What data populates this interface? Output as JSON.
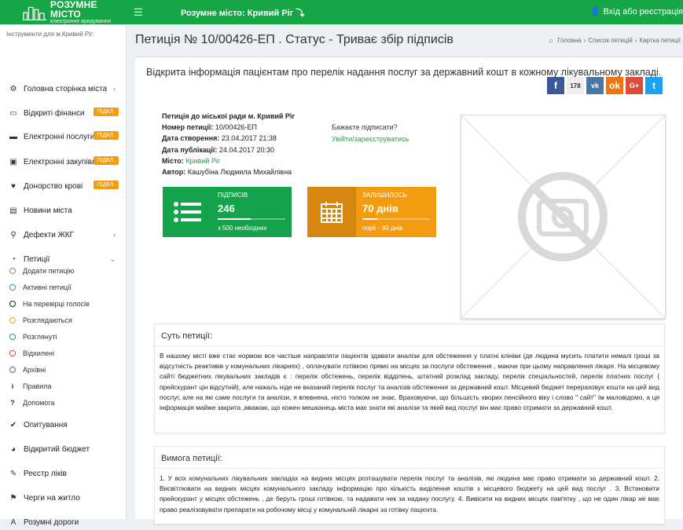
{
  "header": {
    "logo_title": "РОЗУМНЕ МІСТО",
    "logo_subtitle": "електронне врядування",
    "menu_icon": "☰",
    "city_label": "Розумне місто: Кривий Ріг ⤵",
    "login_label": "Вхід або реєстрація"
  },
  "sidebar": {
    "heading": "Інструменти для м.Кривий Ріг:",
    "items": [
      {
        "label": "Головна сторінка міста",
        "icon": "⚙",
        "chev": "‹"
      },
      {
        "label": "Відкриті фінанси",
        "icon": "▭",
        "badge": "ПІДКЛ."
      },
      {
        "label": "Електронні послуги",
        "icon": "▬",
        "badge": "ПІДКЛ."
      },
      {
        "label": "Електронні закупівлі",
        "icon": "▣",
        "badge": "ПІДКЛ."
      },
      {
        "label": "Донорство крові",
        "icon": "♥",
        "badge": "ПІДКЛ."
      },
      {
        "label": "Новини міста",
        "icon": "▤"
      },
      {
        "label": "Дефекти ЖКГ",
        "icon": "⚲",
        "chev": "‹"
      },
      {
        "label": "Петиції",
        "icon": "◔",
        "chev": "⌄"
      }
    ],
    "subitems": [
      {
        "label": "Додати петицію",
        "color": "#888888"
      },
      {
        "label": "Активні петиції",
        "color": "#3c8dbc"
      },
      {
        "label": "На перевірці голосів",
        "color": "#222222"
      },
      {
        "label": "Розглядаються",
        "color": "#f39c12"
      },
      {
        "label": "Розглянуті",
        "color": "#17a645"
      },
      {
        "label": "Відхилені",
        "color": "#dd4b39"
      },
      {
        "label": "Архівні",
        "color": "#666666"
      },
      {
        "label": "Правила",
        "color": "#444444",
        "icon": "i"
      },
      {
        "label": "Допомога",
        "color": "#444444",
        "icon": "?"
      }
    ],
    "bottom": [
      {
        "label": "Опитування",
        "icon": "✔"
      },
      {
        "label": "Відкритий бюджет",
        "icon": "◕"
      },
      {
        "label": "Реєстр ліків",
        "icon": "✎"
      },
      {
        "label": "Черги на житло",
        "icon": "⚑"
      },
      {
        "label": "Розумні дороги",
        "icon": "A"
      }
    ]
  },
  "page": {
    "title": "Петиція № 10/00426-ЕП . Статус - Триває збір підписів",
    "breadcrumb": [
      "Головна",
      "Список петицій",
      "Картка петиції"
    ]
  },
  "petition": {
    "title": "Відкрита інформація пацієнтам про перелік надання послуг за державний кошт в кожному лікувальному закладі.",
    "share_count": "178",
    "to": "Петиція до міської ради м. Кривий Ріг",
    "number_label": "Номер петиції:",
    "number": "10/00426-ЕП",
    "created_label": "Дата створення:",
    "created": "23.04.2017 21:38",
    "published_label": "Дата публікації:",
    "published": "24.04.2017 20:30",
    "city_label": "Місто:",
    "city": "Кривий Ріг",
    "author_label": "Автор:",
    "author": "Кашубіна Людмила Михайлівна",
    "sign_question": "Бажаєте підписати?",
    "sign_link": "Увійти/зареєструватись",
    "signatures": {
      "label": "ПІДПИСІВ",
      "value": "246",
      "foot": "з 500 необхідних",
      "progress": 0.49,
      "color": "#16a34a"
    },
    "remaining": {
      "label": "ЗАЛИШИЛОСЬ",
      "value": "70 днів",
      "foot": "поріг - 90 днів",
      "progress": 0.22,
      "color": "#f39c12"
    },
    "essence_title": "Суть петиції:",
    "essence": "В нашому місті вже стає нормою все частіше направляти пацієнтів здавати аналізи для обстеження у платні клініки (де людина мусить платити немалі гроші за відсутність реактивів у комунальних лікарнях) , оплачувати готівкою прямо на місцях за послуги обстеження , маючи при цьому направлення лікаря. На місцевому сайті бюджетних лікувальних закладів є : перелік обстежень, перелік відділень, штатний розклад закладу, перелік спеціальностей, перелік платних послуг ( прейскурант цін відсутній), але нажаль ніде не вказаний перелік послуг та аналізів обстеження за державний кошт. Місцевий бюджет перераховує кошти на цей вид послуг, але на які саме послуги та аналізи, я впевнена, ніхто толком не знає. Враховуючи, що більшість хворих пенсійного віку і слово \" сайт\" їм маловідомо, а ця інформація майже закрита ,вважаю, що кожен мешканець міста має знати які аналізи та який вид послуг він має право отримати за державний кошт.",
    "demand_title": "Вимога петиції:",
    "demand": "1. У всіх комунальних лікувальних закладах на видних місцях розташувати перелік послуг та аналізів, які людина має право отримати за державний кошт. 2. Висвітлювати на видних місцях комунального закладу інформацію про кількість виділення коштів з місцевого бюджету на цей вид послуг . 3. Встановити прейскурант у місцях обстежень , де беруть гроші готівкою, та надавати чек за надану послугу. 4. Вивісити на видних місцях пам'ятку , що не один лікар не має право реалізовувати препарати на робочому місці у комунальній лікарні за готівку пацієнта."
  }
}
